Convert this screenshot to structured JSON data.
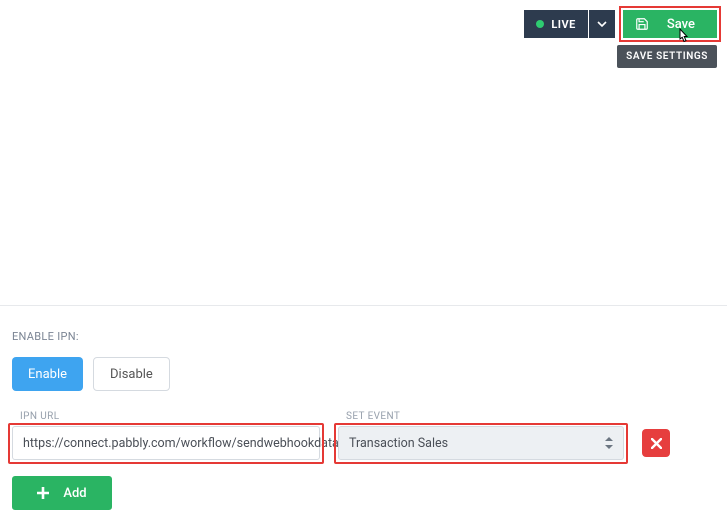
{
  "header": {
    "live_label": "LIVE",
    "save_label": "Save",
    "save_tooltip": "SAVE SETTINGS"
  },
  "ipn": {
    "section_label": "ENABLE IPN:",
    "enable_label": "Enable",
    "disable_label": "Disable",
    "url_label": "IPN URL",
    "url_value": "https://connect.pabbly.com/workflow/sendwebhookdata",
    "event_label": "SET EVENT",
    "event_value": "Transaction Sales",
    "add_label": "Add"
  }
}
